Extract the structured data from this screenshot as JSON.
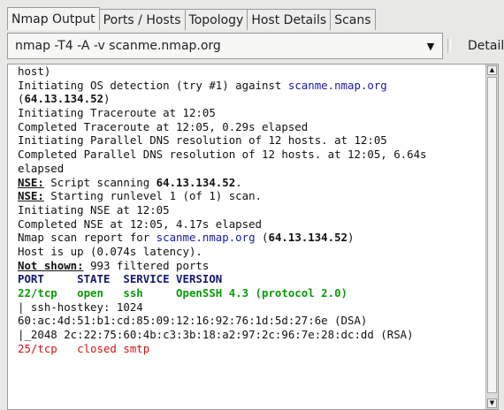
{
  "tabs": [
    {
      "label": "Nmap Output",
      "active": true
    },
    {
      "label": "Ports / Hosts",
      "active": false
    },
    {
      "label": "Topology",
      "active": false
    },
    {
      "label": "Host Details",
      "active": false
    },
    {
      "label": "Scans",
      "active": false
    }
  ],
  "command": {
    "value": "nmap -T4 -A -v scanme.nmap.org",
    "dropdown_icon": "triangle-down",
    "details_label": "Details"
  },
  "output_lines": [
    [
      {
        "t": "host)"
      }
    ],
    [
      {
        "t": "Initiating OS detection (try #1) against "
      },
      {
        "t": "scanme.nmap.org",
        "c": "blue"
      }
    ],
    [
      {
        "t": "("
      },
      {
        "t": "64.13.134.52",
        "c": "bold"
      },
      {
        "t": ")"
      }
    ],
    [
      {
        "t": "Initiating Traceroute at 12:05"
      }
    ],
    [
      {
        "t": "Completed Traceroute at 12:05, 0.29s elapsed"
      }
    ],
    [
      {
        "t": "Initiating Parallel DNS resolution of 12 hosts. at 12:05"
      }
    ],
    [
      {
        "t": "Completed Parallel DNS resolution of 12 hosts. at 12:05, 6.64s"
      }
    ],
    [
      {
        "t": "elapsed"
      }
    ],
    [
      {
        "t": "NSE:",
        "c": "ul"
      },
      {
        "t": " Script scanning "
      },
      {
        "t": "64.13.134.52",
        "c": "bold"
      },
      {
        "t": "."
      }
    ],
    [
      {
        "t": "NSE:",
        "c": "ul"
      },
      {
        "t": " Starting runlevel 1 (of 1) scan."
      }
    ],
    [
      {
        "t": "Initiating NSE at 12:05"
      }
    ],
    [
      {
        "t": "Completed NSE at 12:05, 4.17s elapsed"
      }
    ],
    [
      {
        "t": "Nmap scan report for "
      },
      {
        "t": "scanme.nmap.org",
        "c": "blue"
      },
      {
        "t": " ("
      },
      {
        "t": "64.13.134.52",
        "c": "bold"
      },
      {
        "t": ")"
      }
    ],
    [
      {
        "t": "Host is up (0.074s latency)."
      }
    ],
    [
      {
        "t": "Not shown:",
        "c": "ul"
      },
      {
        "t": " 993 filtered ports"
      }
    ],
    [
      {
        "t": "PORT     STATE  SERVICE VERSION",
        "c": "navy"
      }
    ],
    [
      {
        "t": "22/tcp   open   ssh     OpenSSH 4.3 (protocol 2.0)",
        "c": "green"
      }
    ],
    [
      {
        "t": "| ssh-hostkey: 1024"
      }
    ],
    [
      {
        "t": "60:ac:4d:51:b1:cd:85:09:12:16:92:76:1d:5d:27:6e (DSA)"
      }
    ],
    [
      {
        "t": "|_2048 2c:22:75:60:4b:c3:3b:18:a2:97:2c:96:7e:28:dc:dd (RSA)"
      }
    ],
    [
      {
        "t": "25/tcp   closed smtp",
        "c": "red"
      }
    ]
  ],
  "colors": {
    "link": "#1a1aa6",
    "open_port": "#0a9a0a",
    "closed_port": "#d11414",
    "header": "#111a6e"
  }
}
